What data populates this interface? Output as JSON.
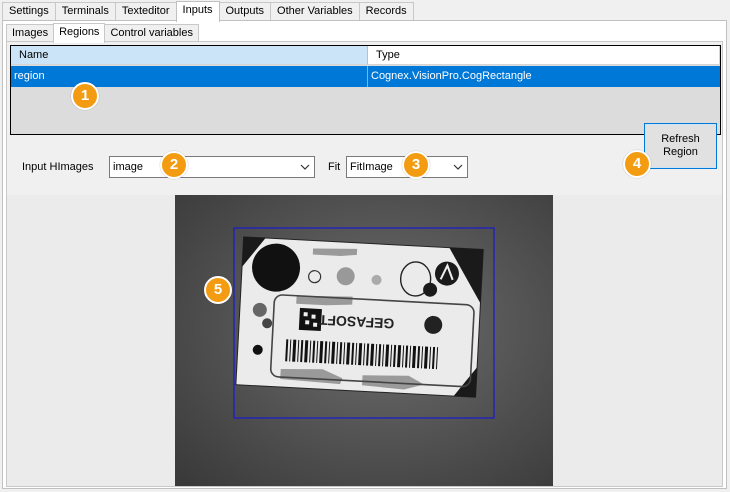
{
  "main_tabs": [
    "Settings",
    "Terminals",
    "Texteditor",
    "Inputs",
    "Outputs",
    "Other Variables",
    "Records"
  ],
  "active_main_tab": "Inputs",
  "sub_tabs": [
    "Images",
    "Regions",
    "Control variables"
  ],
  "active_sub_tab": "Regions",
  "grid": {
    "columns": [
      "Name",
      "Type"
    ],
    "rows": [
      {
        "name": "region",
        "type": "Cognex.VisionPro.CogRectangle"
      }
    ]
  },
  "input_images": {
    "label": "Input HImages",
    "value": "image"
  },
  "fit": {
    "label": "Fit",
    "value": "FitImage"
  },
  "refresh_button": {
    "line1": "Refresh",
    "line2": "Region"
  },
  "callouts": [
    "1",
    "2",
    "3",
    "4",
    "5"
  ],
  "image_text": {
    "brand": "GEFASOFT"
  },
  "colors": {
    "selection": "#0078d7",
    "header_selected": "#cce4f7",
    "callout": "#f39c12",
    "roi": "#1a1acc"
  },
  "icons": {
    "dropdown": "chevron-down-icon"
  }
}
